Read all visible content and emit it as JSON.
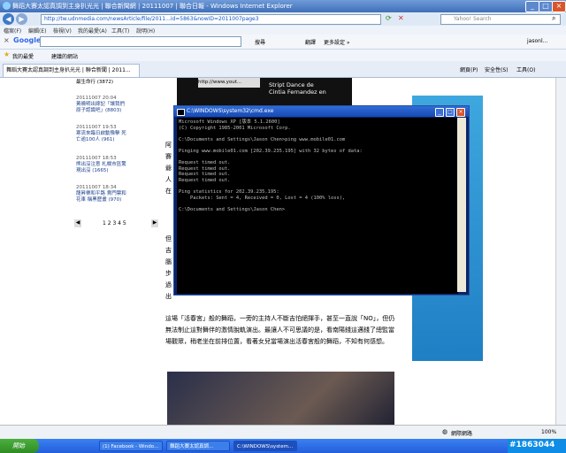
{
  "window": {
    "title": "舞蹈大賽太認真調到主身扒光光 | 聯合新聞網 | 20111007 | 聯合日報 - Windows Internet Explorer",
    "url": "http://tw.udnmedia.com/newsArticle/file/2011...id=5863&nowID=2011007page3",
    "search_placeholder": "Yahoo! Search"
  },
  "menu": [
    "檔案(F)",
    "編輯(E)",
    "檢視(V)",
    "我的最愛(A)",
    "工具(T)",
    "說明(H)"
  ],
  "googlebar": {
    "brand": "Google",
    "go": "搜尋",
    "toolbar_items": [
      "翻譯",
      "更多設定 »"
    ],
    "user": "jasonl..."
  },
  "favbar": {
    "favorites": "我的最愛",
    "suggest": "建議的網站"
  },
  "tab": {
    "label": "舞蹈大賽太認真調到主身扒光光 | 聯合新聞 | 2011..."
  },
  "commandbar": {
    "page": "網頁(P)",
    "safety": "安全性(S)",
    "tools": "工具(O)"
  },
  "sidebar": {
    "top_item": "最生命行 (3872)",
    "items": [
      {
        "date": "20111007 20:04",
        "text": "黃曉明出嫁記「讓我們原子認識吧」(8803)"
      },
      {
        "date": "20111007 19:53",
        "text": "寒流來臨日啟動豫擊 死亡逾100人 (961)"
      },
      {
        "date": "20111007 18:53",
        "text": "熊出沒注意 札幌市區驚現出沒 (1665)"
      },
      {
        "date": "20111007 18:34",
        "text": "龍昇樂和平路 賣門票和花車 稱黑歷畫 (970)"
      }
    ],
    "pages": "1 2 3 4 5"
  },
  "video": {
    "caption": "Stript Dance de Cintia Fernandez en",
    "link": "http://www.yout..."
  },
  "article": {
    "para1_fragments": [
      "阿",
      "賽",
      "爺",
      "人",
      "在"
    ],
    "para2_fragments": [
      "但",
      "吉",
      "腦",
      "步",
      "過",
      "出"
    ],
    "para3": "這場「活春宮」般的舞蹈，一旁的主持人不斷吉怕絕揮手，甚至一直說「NO」，但仍無法制止這對舞伴的激情脫軌演出。最讓人不可思議的是，看南陽錢這邁錢了總監當場觀眾，稍老坐在前排位置，看著女兒當場演出活春宮般的舞蹈，不知有何感想。"
  },
  "cmd": {
    "title": "C:\\WINDOWS\\system32\\cmd.exe",
    "lines": [
      "Microsoft Windows XP [版本 5.1.2600]",
      "(C) Copyright 1985-2001 Microsoft Corp.",
      "",
      "C:\\Documents and Settings\\Jason Chen>ping www.mobile01.com",
      "",
      "Pinging www.mobile01.com [202.39.235.195] with 32 bytes of data:",
      "",
      "Request timed out.",
      "Request timed out.",
      "Request timed out.",
      "Request timed out.",
      "",
      "Ping statistics for 202.39.235.195:",
      "    Packets: Sent = 4, Received = 0, Lost = 4 (100% loss),",
      "",
      "C:\\Documents and Settings\\Jason Chen>"
    ]
  },
  "status": {
    "zone": "網際網路",
    "zoom": "100%"
  },
  "taskbar": {
    "start": "開始",
    "tasks": [
      "(1) Facebook - Windo...",
      "舞蹈大賽太認真調...",
      "C:\\WINDOWS\\system..."
    ],
    "watermark": "#1863044"
  },
  "colors": {
    "ie_blue": "#3f6fb9",
    "cmd_bg": "#000000",
    "cmd_text": "#c0c0c0",
    "taskbar": "#245edb",
    "start_green": "#2f8b24"
  }
}
